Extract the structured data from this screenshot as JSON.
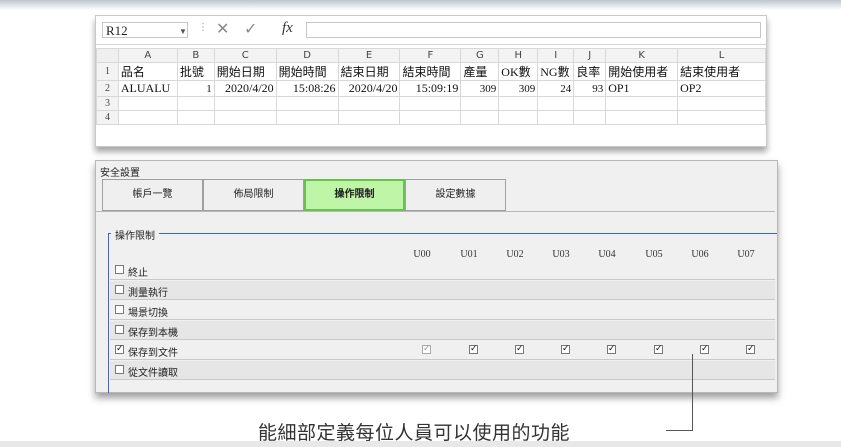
{
  "spreadsheet": {
    "name_box": "R12",
    "fx_label": "fx",
    "columns": [
      "A",
      "B",
      "C",
      "D",
      "E",
      "F",
      "G",
      "H",
      "I",
      "J",
      "K",
      "L"
    ],
    "rows": [
      {
        "num": "1",
        "cells": [
          "品名",
          "批號",
          "開始日期",
          "開始時間",
          "結束日期",
          "結束時間",
          "產量",
          "OK數",
          "NG數",
          "良率",
          "開始使用者",
          "結束使用者"
        ]
      },
      {
        "num": "2",
        "cells": [
          "ALUALU",
          "1",
          "2020/4/20",
          "15:08:26",
          "2020/4/20",
          "15:09:19",
          "309",
          "309",
          "24",
          "93",
          "OP1",
          "OP2"
        ]
      },
      {
        "num": "3",
        "cells": [
          "",
          "",
          "",
          "",
          "",
          "",
          "",
          "",
          "",
          "",
          "",
          ""
        ]
      },
      {
        "num": "4",
        "cells": [
          "",
          "",
          "",
          "",
          "",
          "",
          "",
          "",
          "",
          "",
          "",
          ""
        ]
      }
    ]
  },
  "panel": {
    "title": "安全設置",
    "tabs": [
      {
        "label": "帳戶一覽",
        "active": false
      },
      {
        "label": "佈局限制",
        "active": false
      },
      {
        "label": "操作限制",
        "active": true
      },
      {
        "label": "設定數據",
        "active": false
      }
    ],
    "group_title": "操作限制",
    "user_columns": [
      "U00",
      "U01",
      "U02",
      "U03",
      "U04",
      "U05",
      "U06",
      "U07"
    ],
    "permissions": [
      {
        "label": "終止",
        "checked": false,
        "cells": []
      },
      {
        "label": "測量執行",
        "checked": false,
        "cells": []
      },
      {
        "label": "場景切換",
        "checked": false,
        "cells": []
      },
      {
        "label": "保存到本機",
        "checked": false,
        "cells": []
      },
      {
        "label": "保存到文件",
        "checked": true,
        "cells": [
          true,
          true,
          true,
          true,
          true,
          true,
          true,
          true
        ]
      },
      {
        "label": "從文件讀取",
        "checked": false,
        "cells": []
      }
    ]
  },
  "caption": "能細部定義每位人員可以使用的功能"
}
